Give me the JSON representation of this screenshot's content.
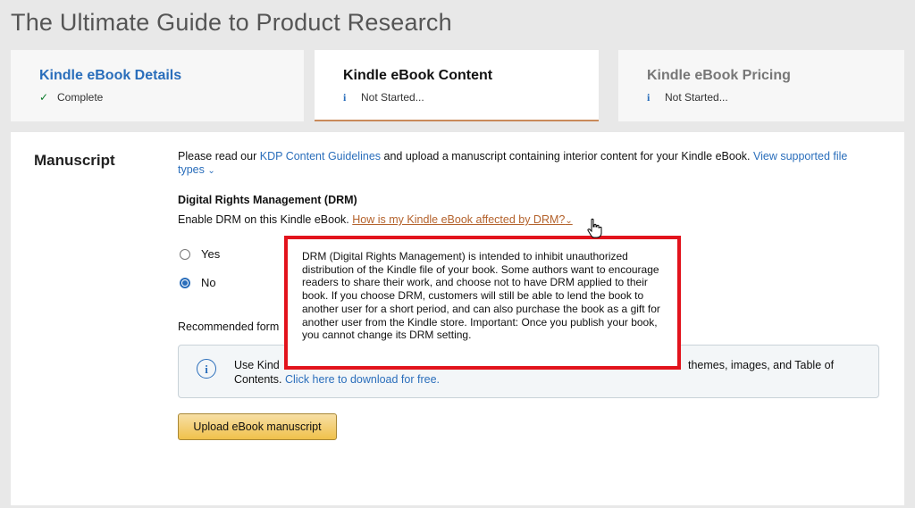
{
  "page_title": "The Ultimate Guide to Product Research",
  "tabs": [
    {
      "title": "Kindle eBook Details",
      "status": "Complete",
      "status_icon": "check-icon",
      "title_color": "#2a6ebb"
    },
    {
      "title": "Kindle eBook Content",
      "status": "Not Started...",
      "status_icon": "info-icon",
      "title_color": "#111111"
    },
    {
      "title": "Kindle eBook Pricing",
      "status": "Not Started...",
      "status_icon": "info-icon",
      "title_color": "#777777"
    }
  ],
  "manuscript": {
    "label": "Manuscript",
    "intro_prefix": "Please read our",
    "guidelines_link": "KDP Content Guidelines",
    "intro_suffix": "and upload a manuscript containing interior content for your Kindle eBook.",
    "file_types_link": "View supported file types",
    "drm_heading": "Digital Rights Management (DRM)",
    "drm_prompt": "Enable DRM on this Kindle eBook.",
    "drm_help_link": "How is my Kindle eBook affected by DRM?",
    "radio_options": [
      {
        "label": "Yes",
        "checked": false
      },
      {
        "label": "No",
        "checked": true
      }
    ],
    "recommended_format_partial": "Recommended form",
    "info_box": {
      "visible_left": "Use Kind",
      "visible_right": "themes, images, and Table of",
      "line2_prefix": "Contents.",
      "line2_link": "Click here to download for free."
    },
    "upload_button": "Upload eBook manuscript"
  },
  "drm_tooltip": {
    "text": "DRM (Digital Rights Management) is intended to inhibit unauthorized distribution of the Kindle file of your book. Some authors want to encourage readers to share their work, and choose not to have DRM applied to their book. If you choose DRM, customers will still be able to lend the book to another user for a short period, and can also purchase the book as a gift for another user from the Kindle store. Important: Once you publish your book, you cannot change its DRM setting.",
    "highlight_color": "#e2131c"
  },
  "colors": {
    "link": "#2a6ebb",
    "drm_help_link": "#b4622c",
    "button": "#f0c14b",
    "active_tab_underline": "#c98a5a"
  }
}
